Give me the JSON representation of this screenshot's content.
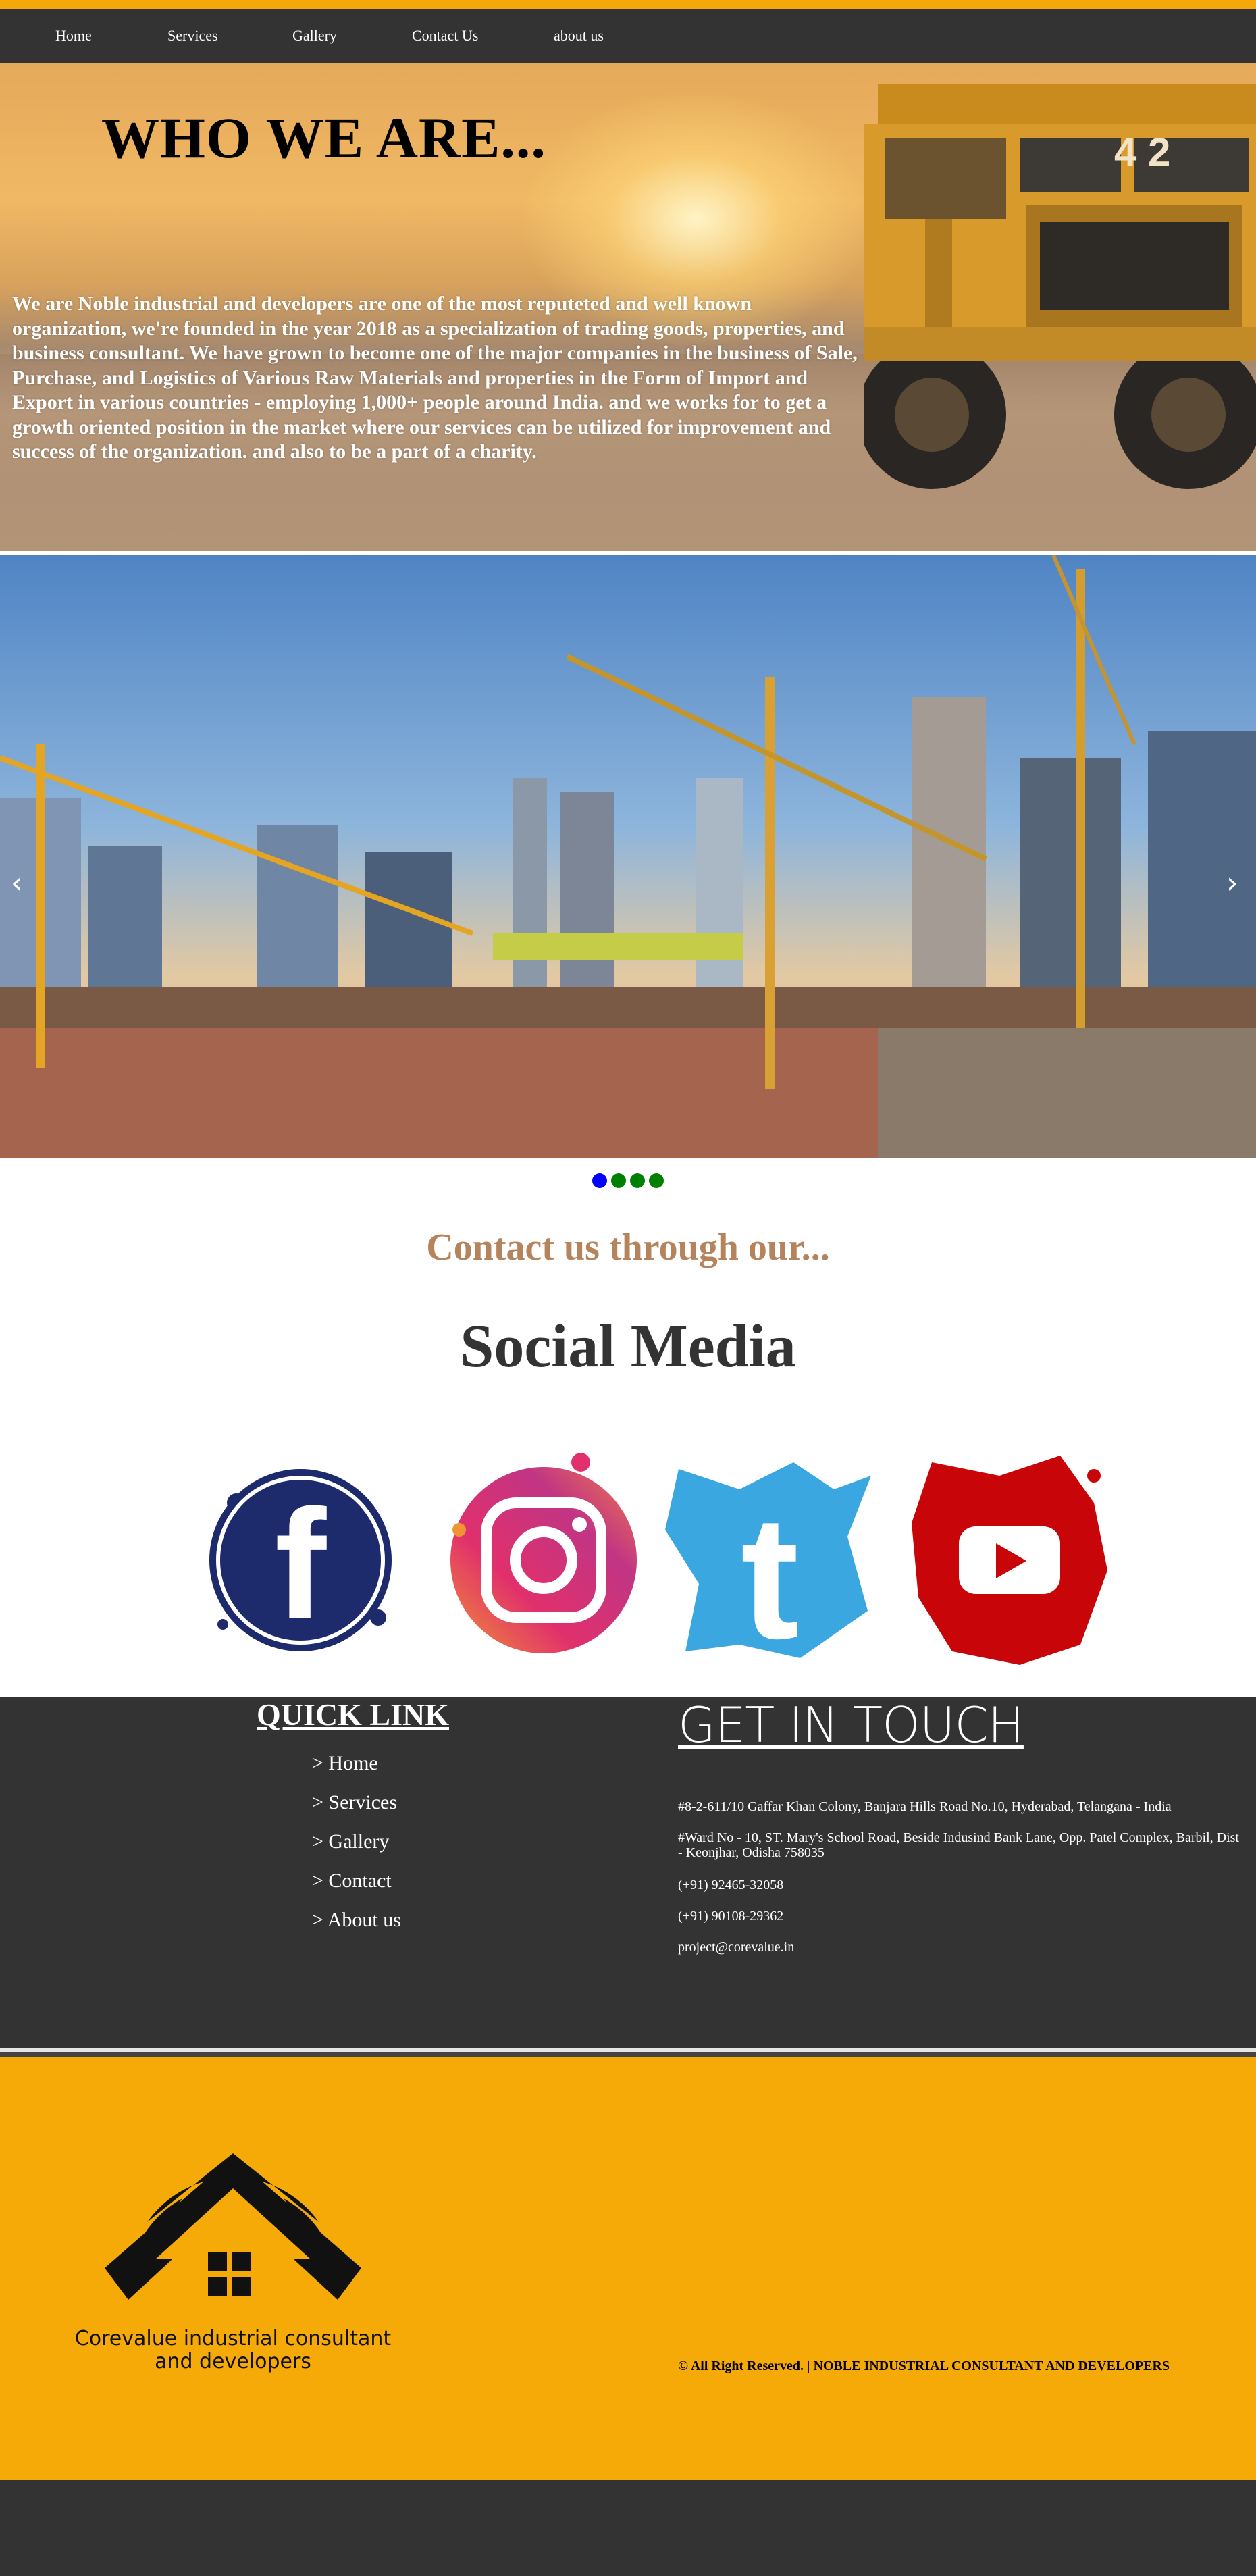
{
  "nav": {
    "items": [
      {
        "label": "Home"
      },
      {
        "label": "Services"
      },
      {
        "label": "Gallery"
      },
      {
        "label": "Contact Us"
      },
      {
        "label": "about us"
      }
    ]
  },
  "hero": {
    "title": "WHO WE ARE...",
    "text": "We are Noble industrial and developers are one of the most reputeted and well known organization, we're founded in the year 2018 as a specialization of trading goods, properties, and business consultant. We have grown to become one of the major companies in the business of Sale, Purchase, and Logistics of Various Raw Materials and properties in the Form of Import and Export in various countries - employing 1,000+ people around India. and we works for to get a growth oriented position in the market where our services can be utilized for improvement and success of the organization. and also to be a part of a charity.",
    "truck_number": "4 2"
  },
  "carousel": {
    "prev_icon": "‹",
    "next_icon": "›",
    "slide_count": 4,
    "active_index": 0,
    "active_color": "#0000ff",
    "inactive_color": "#008000"
  },
  "contact": {
    "heading": "Contact us through our...",
    "subheading": "Social Media"
  },
  "social": [
    {
      "icon": "facebook-icon",
      "color": "#1d2a6b"
    },
    {
      "icon": "instagram-icon",
      "color": "#e1306c"
    },
    {
      "icon": "twitter-icon",
      "color": "#1da1f2"
    },
    {
      "icon": "youtube-icon",
      "color": "#cc0000"
    }
  ],
  "footer": {
    "quick_link_title": "QUICK LINK",
    "links": [
      {
        "label": "> Home"
      },
      {
        "label": "> Services"
      },
      {
        "label": "> Gallery"
      },
      {
        "label": "> Contact"
      },
      {
        "label": "> About us"
      }
    ],
    "get_in_touch_title": "GET IN TOUCH",
    "address1": "#8-2-611/10 Gaffar Khan Colony, Banjara Hills Road No.10, Hyderabad, Telangana - India",
    "address2": "#Ward No - 10, ST. Mary's School Road, Beside Indusind Bank Lane, Opp. Patel Complex, Barbil, Dist - Keonjhar, Odisha 758035",
    "phone1": "(+91) 92465-32058",
    "phone2": "(+91) 90108-29362",
    "email": "project@corevalue.in"
  },
  "brand": {
    "logo_line1": "Corevalue industrial consultant",
    "logo_line2": "and developers",
    "copyright": "© All Right Reserved. | NOBLE INDUSTRIAL CONSULTANT AND DEVELOPERS"
  },
  "colors": {
    "accent": "#f5aa08",
    "dark": "#333333",
    "heading_tan": "#b5845c"
  }
}
